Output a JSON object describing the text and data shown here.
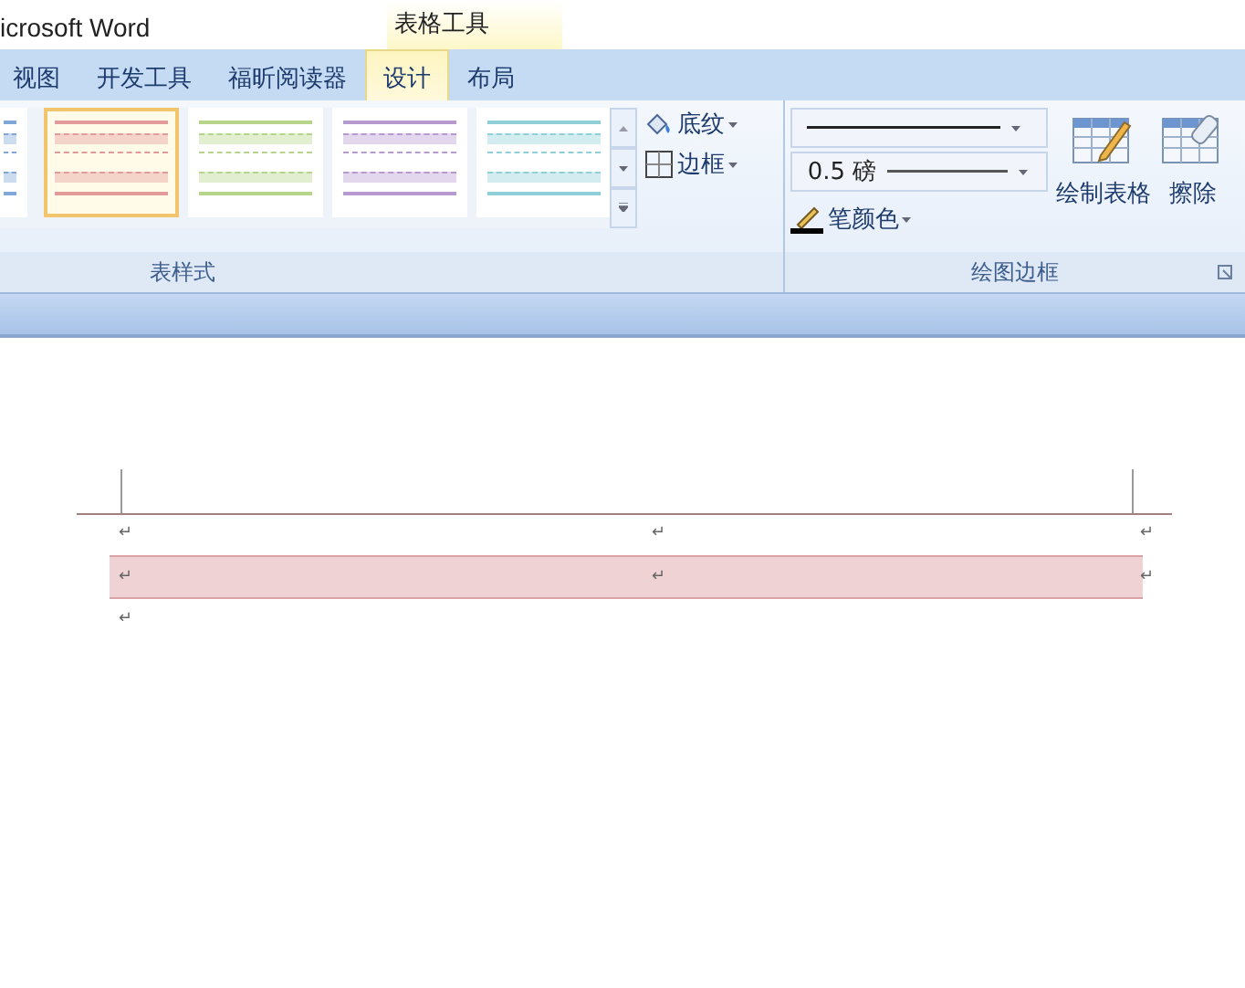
{
  "window": {
    "title": "icrosoft Word"
  },
  "context_tab_group": {
    "label": "表格工具"
  },
  "tabs": [
    {
      "label": "视图",
      "selected": false
    },
    {
      "label": "开发工具",
      "selected": false
    },
    {
      "label": "福昕阅读器",
      "selected": false
    },
    {
      "label": "设计",
      "selected": true
    },
    {
      "label": "布局",
      "selected": false
    }
  ],
  "table_styles_group": {
    "label": "表样式",
    "styles": [
      {
        "color": "#7fa8d8",
        "selected": false,
        "partial": true
      },
      {
        "color": "#e39a9a",
        "selected": true
      },
      {
        "color": "#b7d58a",
        "selected": false
      },
      {
        "color": "#b79ad0",
        "selected": false
      },
      {
        "color": "#8fd0d8",
        "selected": false
      }
    ],
    "shading": {
      "label": "底纹"
    },
    "borders": {
      "label": "边框"
    }
  },
  "draw_borders_group": {
    "label": "绘图边框",
    "pen_weight": "0.5 磅",
    "pen_color": {
      "label": "笔颜色"
    },
    "buttons": [
      {
        "label": "绘制表格",
        "kind": "pencil"
      },
      {
        "label": "擦除",
        "kind": "eraser"
      }
    ]
  },
  "document": {
    "table_rows": [
      {
        "shaded": false,
        "cells": [
          "↵",
          "↵"
        ],
        "row_end": "↵"
      },
      {
        "shaded": true,
        "cells": [
          "↵",
          "↵"
        ],
        "row_end": "↵"
      }
    ],
    "after_paragraph": "↵"
  }
}
